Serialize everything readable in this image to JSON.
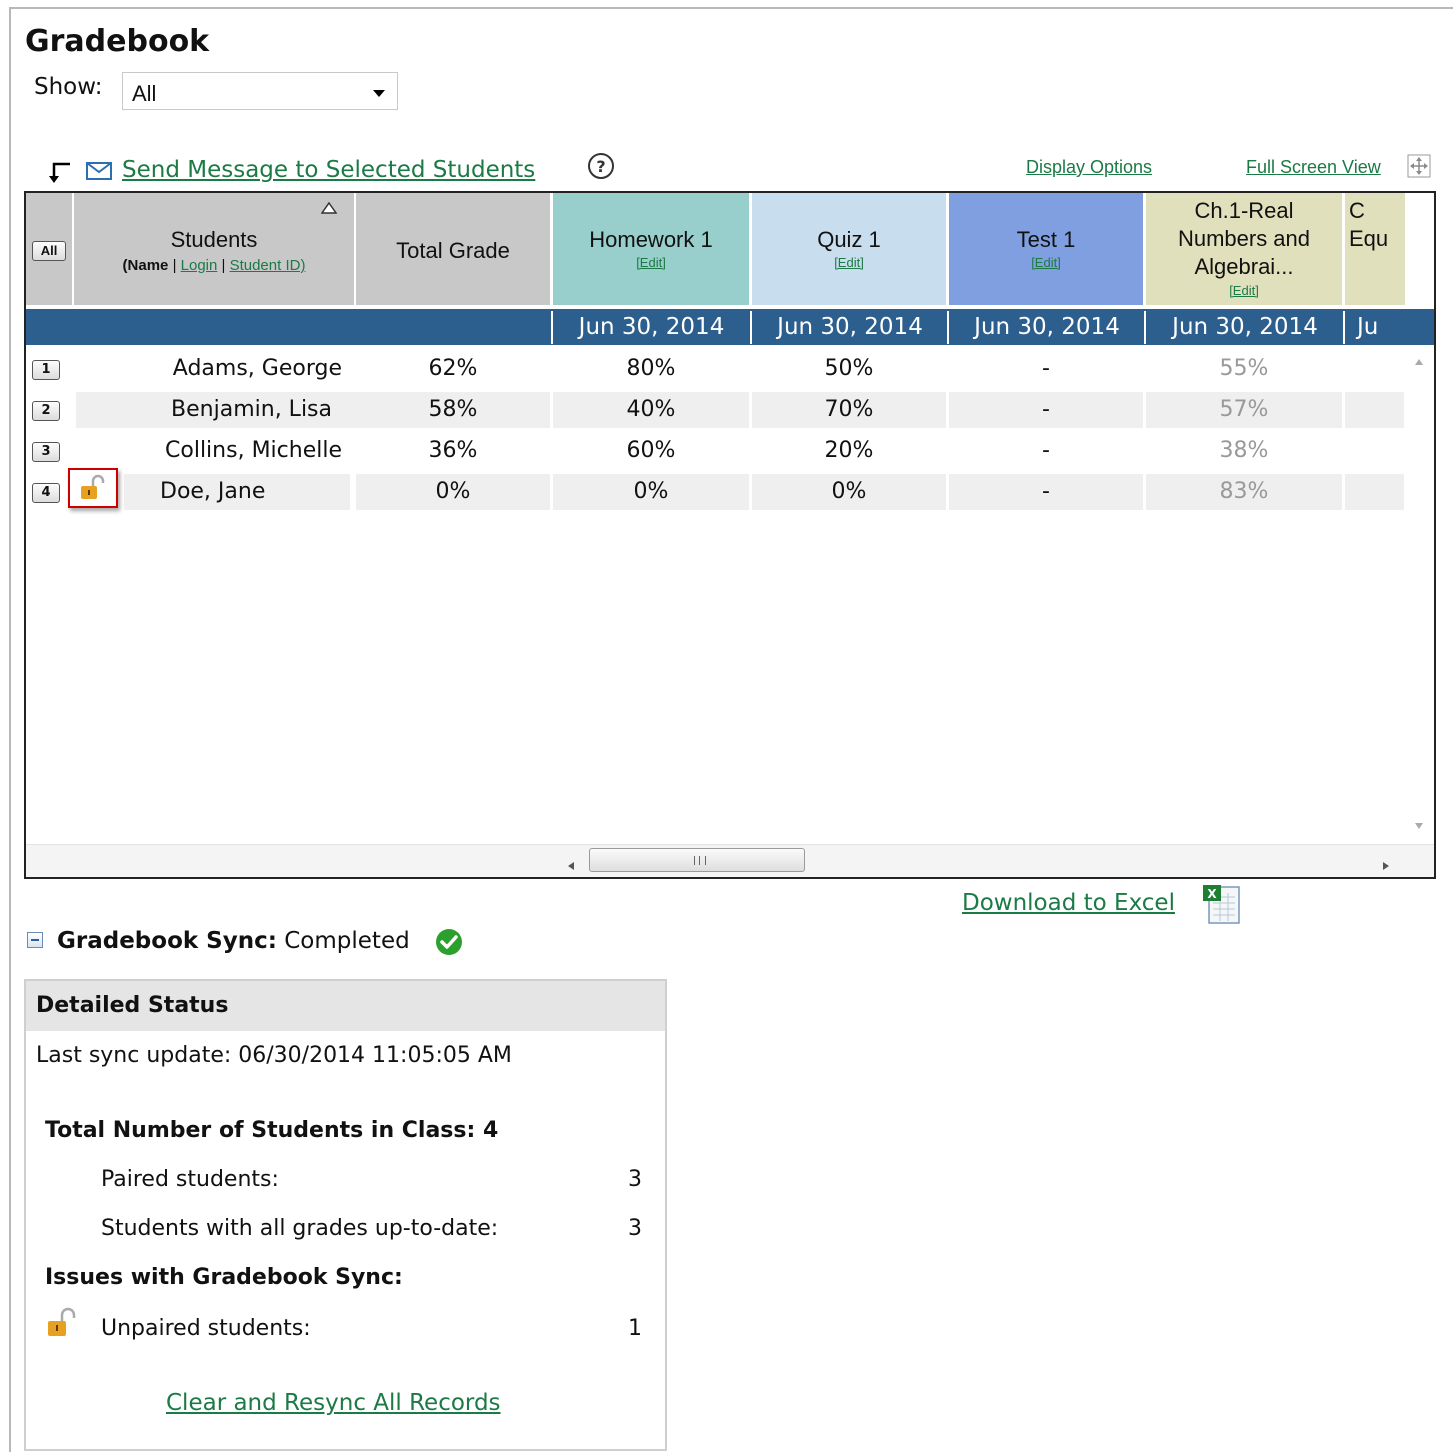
{
  "page": {
    "title": "Gradebook"
  },
  "filter": {
    "label": "Show:",
    "value": "All"
  },
  "toolbar": {
    "send_message": "Send Message to Selected Students",
    "display_options": "Display Options",
    "full_screen": "Full Screen View"
  },
  "grid": {
    "select_all": "All",
    "students_header": "Students",
    "students_sub_prefix": "(Name",
    "students_sub_login": "Login",
    "students_sub_id": "Student ID)",
    "total_header": "Total Grade",
    "edit_label": "[Edit]",
    "columns": [
      {
        "title": "Homework 1",
        "date": "Jun 30, 2014",
        "color": "#98cfcc"
      },
      {
        "title": "Quiz 1",
        "date": "Jun 30, 2014",
        "color": "#c8ddee"
      },
      {
        "title": "Test 1",
        "date": "Jun 30, 2014",
        "color": "#7f9fe0"
      },
      {
        "title_1": "Ch.1-Real",
        "title_2": "Numbers and",
        "title_3": "Algebrai...",
        "date": "Jun 30, 2014",
        "color": "#e1e0bd"
      },
      {
        "title_1": "C",
        "title_2": "Equ",
        "date": "Ju",
        "color": "#e1e0bd"
      }
    ],
    "rows": [
      {
        "num": "1",
        "name": "Adams, George",
        "total": "62%",
        "hw1": "80%",
        "quiz1": "50%",
        "test1": "-",
        "ch1": "55%"
      },
      {
        "num": "2",
        "name": "Benjamin, Lisa",
        "total": "58%",
        "hw1": "40%",
        "quiz1": "70%",
        "test1": "-",
        "ch1": "57%"
      },
      {
        "num": "3",
        "name": "Collins, Michelle",
        "total": "36%",
        "hw1": "60%",
        "quiz1": "20%",
        "test1": "-",
        "ch1": "38%"
      },
      {
        "num": "4",
        "name": "Doe, Jane",
        "total": "0%",
        "hw1": "0%",
        "quiz1": "0%",
        "test1": "-",
        "ch1": "83%"
      }
    ]
  },
  "download": {
    "label": "Download to Excel"
  },
  "sync": {
    "label": "Gradebook Sync:",
    "status": "Completed"
  },
  "detail": {
    "header": "Detailed Status",
    "last_sync": "Last sync update: 06/30/2014 11:05:05 AM",
    "total_students": "Total Number of Students in Class: 4",
    "paired_label": "Paired students:",
    "paired_value": "3",
    "uptodate_label": "Students with all grades up-to-date:",
    "uptodate_value": "3",
    "issues_header": "Issues with Gradebook Sync:",
    "unpaired_label": "Unpaired students:",
    "unpaired_value": "1",
    "resync_link": "Clear and Resync All Records"
  },
  "colors": {
    "link": "#1b7a45",
    "date_band": "#2d5f8e",
    "lock": "#e8a020",
    "success": "#2ca02c"
  }
}
